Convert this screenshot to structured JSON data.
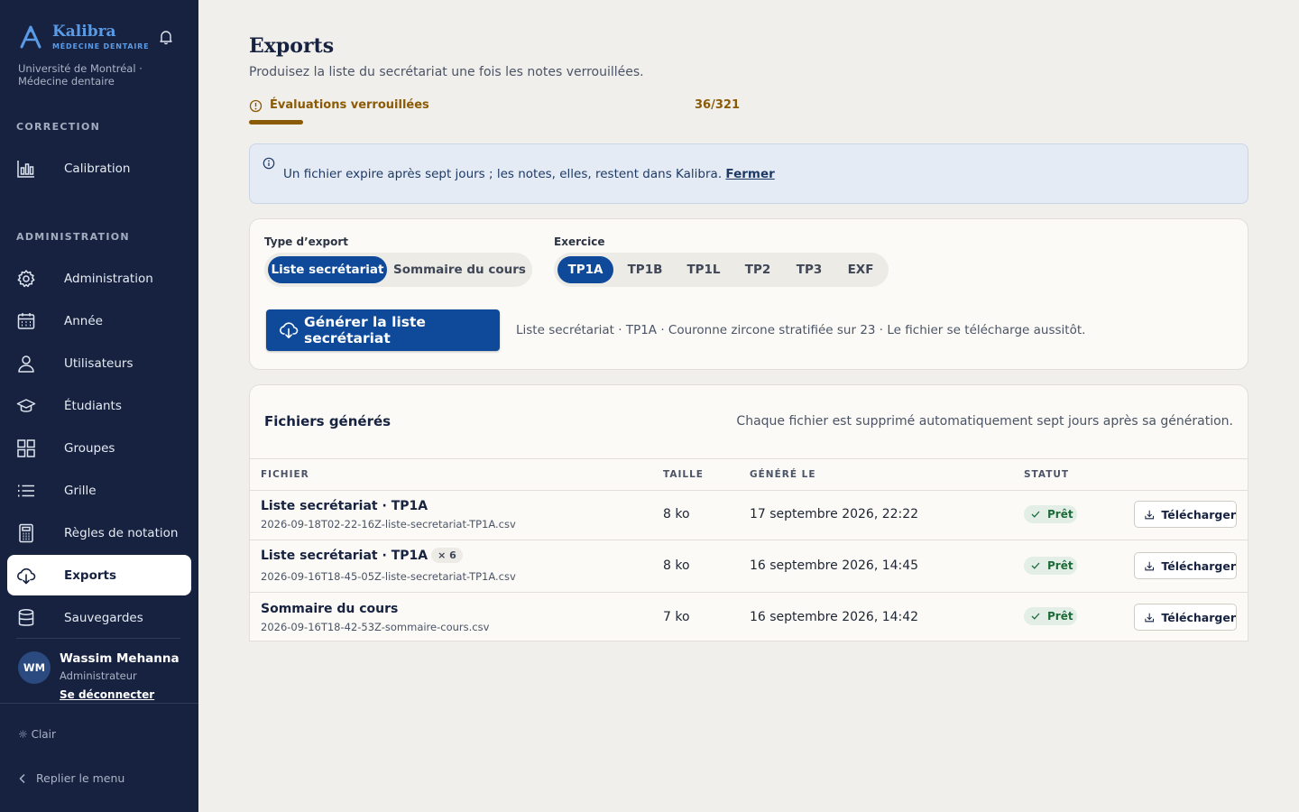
{
  "sidebar": {
    "brand_name": "Kalibra",
    "brand_sub": "MÉDECINE DENTAIRE",
    "org_line1": "Université de Montréal ·",
    "org_line2": "Médecine dentaire",
    "section_correction": "CORRECTION",
    "section_admin": "ADMINISTRATION",
    "items": [
      {
        "label": "Calibration",
        "icon": "bar-chart-icon"
      },
      {
        "label": "Administration",
        "icon": "gear-icon"
      },
      {
        "label": "Année",
        "icon": "calendar-icon"
      },
      {
        "label": "Utilisateurs",
        "icon": "user-icon"
      },
      {
        "label": "Étudiants",
        "icon": "graduation-cap-icon"
      },
      {
        "label": "Groupes",
        "icon": "grid-icon"
      },
      {
        "label": "Grille",
        "icon": "list-icon"
      },
      {
        "label": "Règles de notation",
        "icon": "calculator-icon"
      },
      {
        "label": "Exports",
        "icon": "cloud-download-icon",
        "active": true
      },
      {
        "label": "Sauvegardes",
        "icon": "database-icon"
      }
    ],
    "user": {
      "initials": "WM",
      "name": "Wassim Mehanna",
      "role": "Administrateur",
      "logout": "Se déconnecter"
    },
    "theme": "☼ Clair",
    "collapse": "Replier le menu"
  },
  "main": {
    "title": "Exports",
    "subtitle": "Produisez la liste du secrétariat une fois les notes verrouillées.",
    "lock": {
      "label": "Évaluations verrouillées",
      "count": "36/321",
      "progress": 0.112
    },
    "info": {
      "text": "Un fichier expire après sept jours ; les notes, elles, restent dans Kalibra. ",
      "link": "Fermer"
    },
    "export_type": {
      "label": "Type d’export",
      "options": [
        "Liste secrétariat",
        "Sommaire du cours"
      ],
      "selected": "Liste secrétariat"
    },
    "exercise": {
      "label": "Exercice",
      "options": [
        "TP1A",
        "TP1B",
        "TP1L",
        "TP2",
        "TP3",
        "EXF"
      ],
      "selected": "TP1A"
    },
    "generate_button": "Générer la liste secrétariat",
    "generate_desc": "Liste secrétariat · TP1A · Couronne zircone stratifiée sur 23 · Le fichier se télécharge aussitôt.",
    "files": {
      "title": "Fichiers générés",
      "note": "Chaque fichier est supprimé automatiquement sept jours après sa génération.",
      "columns": [
        "FICHIER",
        "TAILLE",
        "GÉNÉRÉ LE",
        "STATUT"
      ],
      "rows": [
        {
          "name": "Liste secrétariat · TP1A",
          "dup": "",
          "path": "2026-09-18T02-22-16Z-liste-secretariat-TP1A.csv",
          "size": "8 ko",
          "date": "17 septembre 2026, 22:22",
          "status": "Prêt",
          "action": "Télécharger"
        },
        {
          "name": "Liste secrétariat · TP1A",
          "dup": "× 6",
          "path": "2026-09-16T18-45-05Z-liste-secretariat-TP1A.csv",
          "size": "8 ko",
          "date": "16 septembre 2026, 14:45",
          "status": "Prêt",
          "action": "Télécharger"
        },
        {
          "name": "Sommaire du cours",
          "dup": "",
          "path": "2026-09-16T18-42-53Z-sommaire-cours.csv",
          "size": "7 ko",
          "date": "16 septembre 2026, 14:42",
          "status": "Prêt",
          "action": "Télécharger"
        }
      ]
    }
  }
}
